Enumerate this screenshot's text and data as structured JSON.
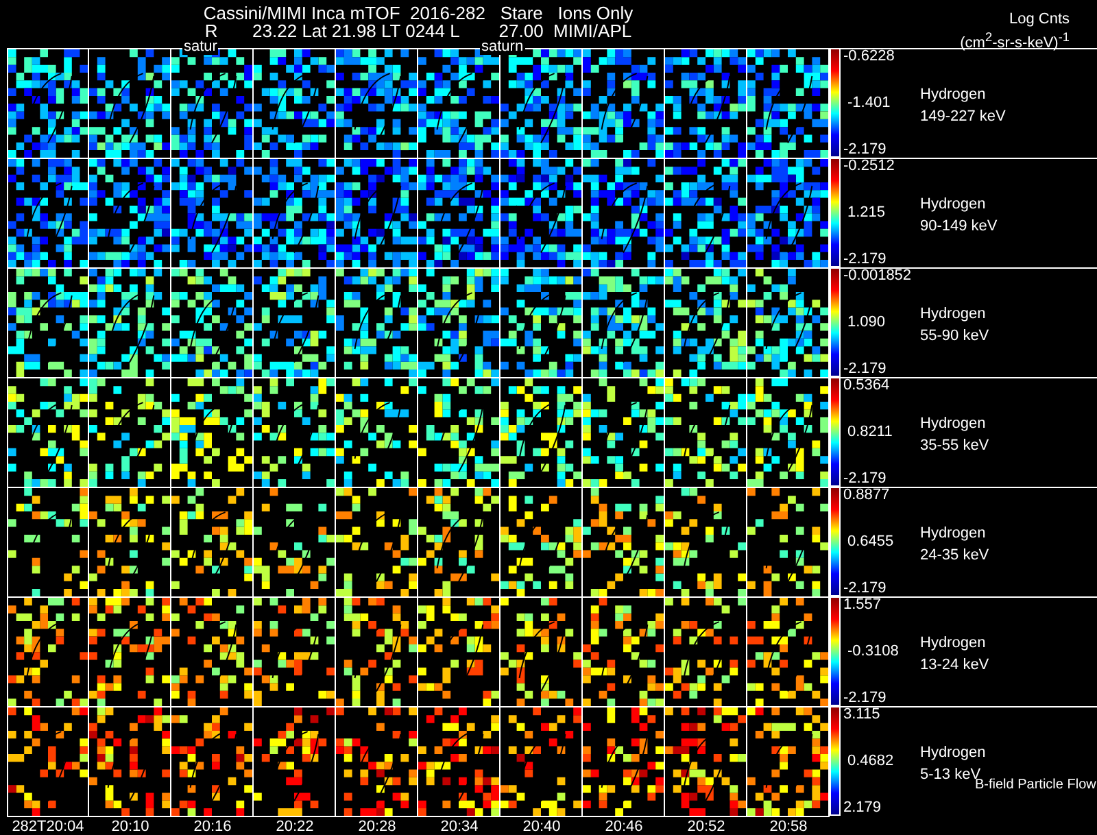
{
  "title": "Cassini/MIMI Inca mTOF  2016-282   Stare   Ions Only",
  "subtitle": "R       23.22 Lat 21.98 LT 0244 L        27.00  MIMI/APL",
  "colorbar_title": "Log Cnts",
  "colorbar_units": "(cm$^{2}$-sr-s-keV)$^{-1}$",
  "overlay_labels": [
    {
      "text": "satur"
    },
    {
      "text": "saturn"
    }
  ],
  "rows": [
    {
      "species": "Hydrogen",
      "energy": "149-227 keV",
      "max": "-0.6228",
      "mid": "-1.401",
      "min": "-2.179"
    },
    {
      "species": "Hydrogen",
      "energy": "90-149 keV",
      "max": "-0.2512",
      "mid": "1.215",
      "min": "-2.179"
    },
    {
      "species": "Hydrogen",
      "energy": "55-90 keV",
      "max": "-0.001852",
      "mid": "1.090",
      "min": "-2.179"
    },
    {
      "species": "Hydrogen",
      "energy": "35-55 keV",
      "max": "0.5364",
      "mid": "0.8211",
      "min": "-2.179"
    },
    {
      "species": "Hydrogen",
      "energy": "24-35 keV",
      "max": "0.8877",
      "mid": "0.6455",
      "min": "-2.179"
    },
    {
      "species": "Hydrogen",
      "energy": "13-24 keV",
      "max": "1.557",
      "mid": "-0.3108",
      "min": "-2.179"
    },
    {
      "species": "Hydrogen",
      "energy": "5-13 keV",
      "max": "3.115",
      "mid": "0.4682",
      "min": "2.179"
    }
  ],
  "legend_note": "B-field Particle Flow",
  "times": [
    "282T20:04",
    "20:10",
    "20:16",
    "20:22",
    "20:28",
    "20:34",
    "20:40",
    "20:46",
    "20:52",
    "20:58"
  ]
}
